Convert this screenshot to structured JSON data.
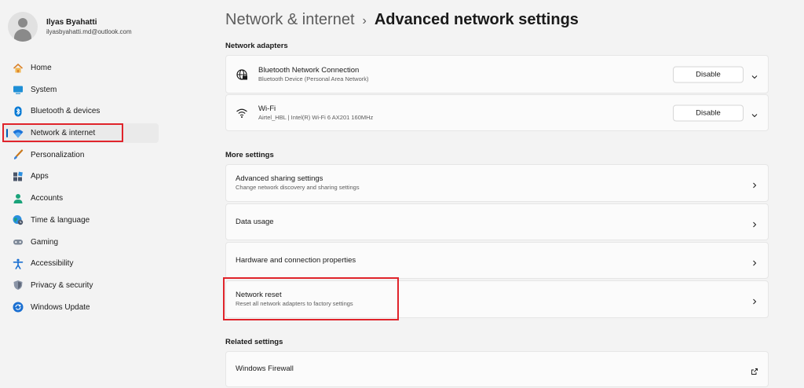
{
  "profile": {
    "name": "Ilyas Byahatti",
    "email": "ilyasbyahatti.md@outlook.com"
  },
  "sidebar": {
    "items": [
      {
        "label": "Home",
        "icon": "home-icon"
      },
      {
        "label": "System",
        "icon": "system-icon"
      },
      {
        "label": "Bluetooth & devices",
        "icon": "bluetooth-icon"
      },
      {
        "label": "Network & internet",
        "icon": "wifi-icon",
        "selected": true
      },
      {
        "label": "Personalization",
        "icon": "brush-icon"
      },
      {
        "label": "Apps",
        "icon": "apps-icon"
      },
      {
        "label": "Accounts",
        "icon": "account-icon"
      },
      {
        "label": "Time & language",
        "icon": "globe-clock-icon"
      },
      {
        "label": "Gaming",
        "icon": "gamepad-icon"
      },
      {
        "label": "Accessibility",
        "icon": "accessibility-icon"
      },
      {
        "label": "Privacy & security",
        "icon": "shield-icon"
      },
      {
        "label": "Windows Update",
        "icon": "update-icon"
      }
    ]
  },
  "breadcrumb": {
    "parent": "Network & internet",
    "separator": "›",
    "current": "Advanced network settings"
  },
  "sections": {
    "adapters": "Network adapters",
    "more": "More settings",
    "related": "Related settings"
  },
  "adapters": [
    {
      "title": "Bluetooth Network Connection",
      "subtitle": "Bluetooth Device (Personal Area Network)",
      "button": "Disable",
      "icon": "ethernet-globe-icon"
    },
    {
      "title": "Wi-Fi",
      "subtitle": "Airtel_HBL | Intel(R) Wi-Fi 6 AX201 160MHz",
      "button": "Disable",
      "icon": "wifi-icon"
    }
  ],
  "more_settings": [
    {
      "title": "Advanced sharing settings",
      "subtitle": "Change network discovery and sharing settings"
    },
    {
      "title": "Data usage",
      "subtitle": ""
    },
    {
      "title": "Hardware and connection properties",
      "subtitle": ""
    },
    {
      "title": "Network reset",
      "subtitle": "Reset all network adapters to factory settings"
    }
  ],
  "related_settings": [
    {
      "title": "Windows Firewall",
      "icon": "open-external-icon"
    }
  ],
  "colors": {
    "accent": "#005fb8",
    "highlight": "#e0242b",
    "background": "#f3f3f3",
    "card": "#fbfbfb"
  }
}
